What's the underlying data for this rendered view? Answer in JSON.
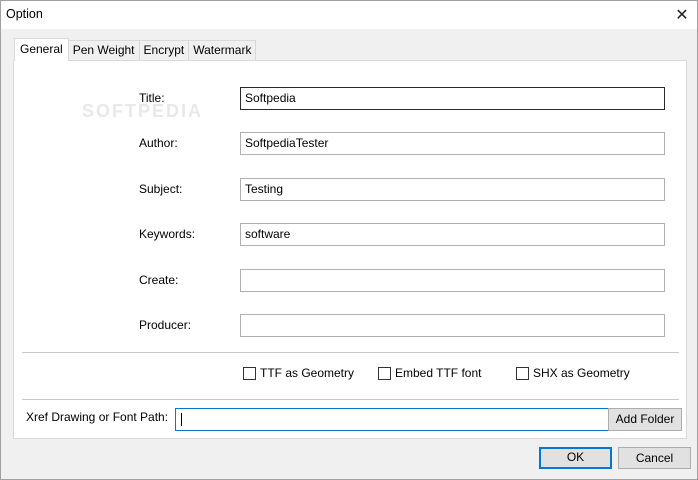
{
  "window": {
    "title": "Option"
  },
  "tabs": [
    {
      "label": "General"
    },
    {
      "label": "Pen Weight"
    },
    {
      "label": "Encrypt"
    },
    {
      "label": "Watermark"
    }
  ],
  "watermark_text": "SOFTPEDIA",
  "fields": {
    "title": {
      "label": "Title:",
      "value": "Softpedia"
    },
    "author": {
      "label": "Author:",
      "value": "SoftpediaTester"
    },
    "subject": {
      "label": "Subject:",
      "value": "Testing"
    },
    "keywords": {
      "label": "Keywords:",
      "value": "software"
    },
    "create": {
      "label": "Create:",
      "value": ""
    },
    "producer": {
      "label": "Producer:",
      "value": ""
    }
  },
  "options": {
    "ttf_geometry": {
      "label": "TTF as Geometry",
      "checked": false
    },
    "embed_ttf": {
      "label": "Embed TTF font",
      "checked": false
    },
    "shx_geometry": {
      "label": "SHX as Geometry",
      "checked": false
    }
  },
  "xref": {
    "label": "Xref Drawing or Font Path:",
    "value": "",
    "add_folder_label": "Add Folder"
  },
  "buttons": {
    "ok": "OK",
    "cancel": "Cancel"
  }
}
